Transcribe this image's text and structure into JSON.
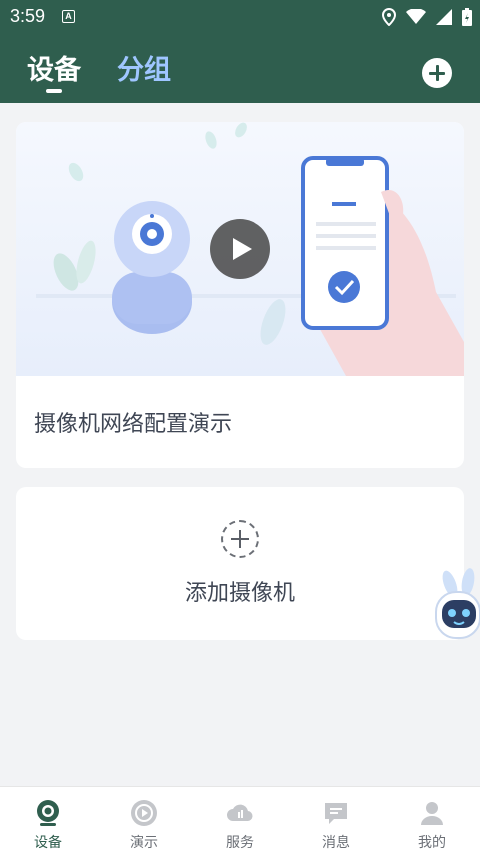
{
  "status_bar": {
    "time": "3:59",
    "notification_icon_letter": "A"
  },
  "header": {
    "tabs": [
      {
        "label": "设备",
        "active": true
      },
      {
        "label": "分组",
        "active": false
      }
    ],
    "add_icon": "plus-circle-icon"
  },
  "demo_card": {
    "title": "摄像机网络配置演示",
    "play_icon": "play-icon"
  },
  "add_card": {
    "label": "添加摄像机",
    "icon": "dashed-plus-icon"
  },
  "bottom_nav": {
    "items": [
      {
        "label": "设备",
        "icon": "camera-icon",
        "active": true
      },
      {
        "label": "演示",
        "icon": "play-circle-icon",
        "active": false
      },
      {
        "label": "服务",
        "icon": "cloud-icon",
        "active": false
      },
      {
        "label": "消息",
        "icon": "message-icon",
        "active": false
      },
      {
        "label": "我的",
        "icon": "person-icon",
        "active": false
      }
    ]
  },
  "colors": {
    "header_bg": "#2f5e4e",
    "inactive_tab": "#9fc6ff",
    "page_bg": "#f2f3f5",
    "accent_blue": "#4a78d6"
  }
}
